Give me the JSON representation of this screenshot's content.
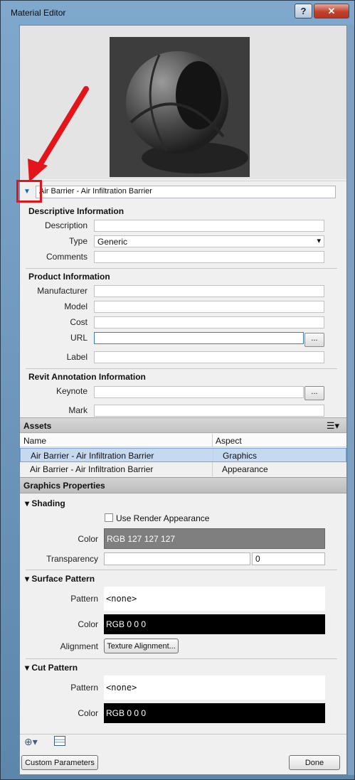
{
  "window": {
    "title": "Material Editor",
    "help_label": "?",
    "close_label": "✕"
  },
  "material_name": "Air Barrier - Air Infiltration Barrier",
  "descriptive": {
    "title": "Descriptive Information",
    "description_label": "Description",
    "description_value": "",
    "type_label": "Type",
    "type_value": "Generic",
    "comments_label": "Comments",
    "comments_value": ""
  },
  "product": {
    "title": "Product Information",
    "manufacturer_label": "Manufacturer",
    "model_label": "Model",
    "cost_label": "Cost",
    "url_label": "URL",
    "label_label": "Label",
    "browse_label": "..."
  },
  "annotation": {
    "title": "Revit Annotation Information",
    "keynote_label": "Keynote",
    "mark_label": "Mark",
    "browse_label": "..."
  },
  "assets": {
    "title": "Assets",
    "col_name": "Name",
    "col_aspect": "Aspect",
    "rows": [
      {
        "name": "Air Barrier - Air Infiltration Barrier",
        "aspect": "Graphics"
      },
      {
        "name": "Air Barrier - Air Infiltration Barrier",
        "aspect": "Appearance"
      }
    ]
  },
  "graphics": {
    "title": "Graphics Properties",
    "shading": {
      "title": "Shading",
      "use_render_label": "Use Render Appearance",
      "color_label": "Color",
      "color_value": "RGB 127 127 127",
      "color_hex": "#7f7f7f",
      "transparency_label": "Transparency",
      "transparency_value": "0"
    },
    "surface": {
      "title": "Surface Pattern",
      "pattern_label": "Pattern",
      "pattern_value": "<none>",
      "color_label": "Color",
      "color_value": "RGB 0 0 0",
      "alignment_label": "Alignment",
      "alignment_button": "Texture Alignment..."
    },
    "cut": {
      "title": "Cut Pattern",
      "pattern_label": "Pattern",
      "pattern_value": "<none>",
      "color_label": "Color",
      "color_value": "RGB 0 0 0"
    }
  },
  "footer": {
    "custom_params": "Custom Parameters",
    "done": "Done"
  },
  "colors": {
    "annotation_red": "#e3141a",
    "selected_row": "#c5d9f1"
  }
}
